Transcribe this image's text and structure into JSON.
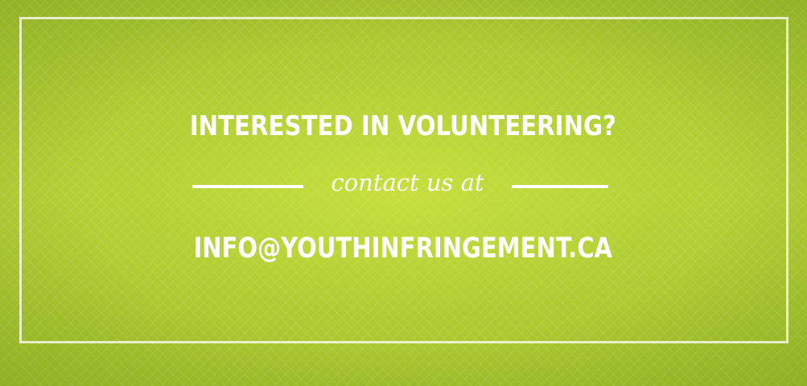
{
  "headline": "INTERESTED IN VOLUNTEERING?",
  "subline": "contact us at",
  "email": "INFO@YOUTHINFRINGEMENT.CA",
  "colors": {
    "background": "#a8c832",
    "text": "#ffffff",
    "frame": "#ffffff"
  }
}
